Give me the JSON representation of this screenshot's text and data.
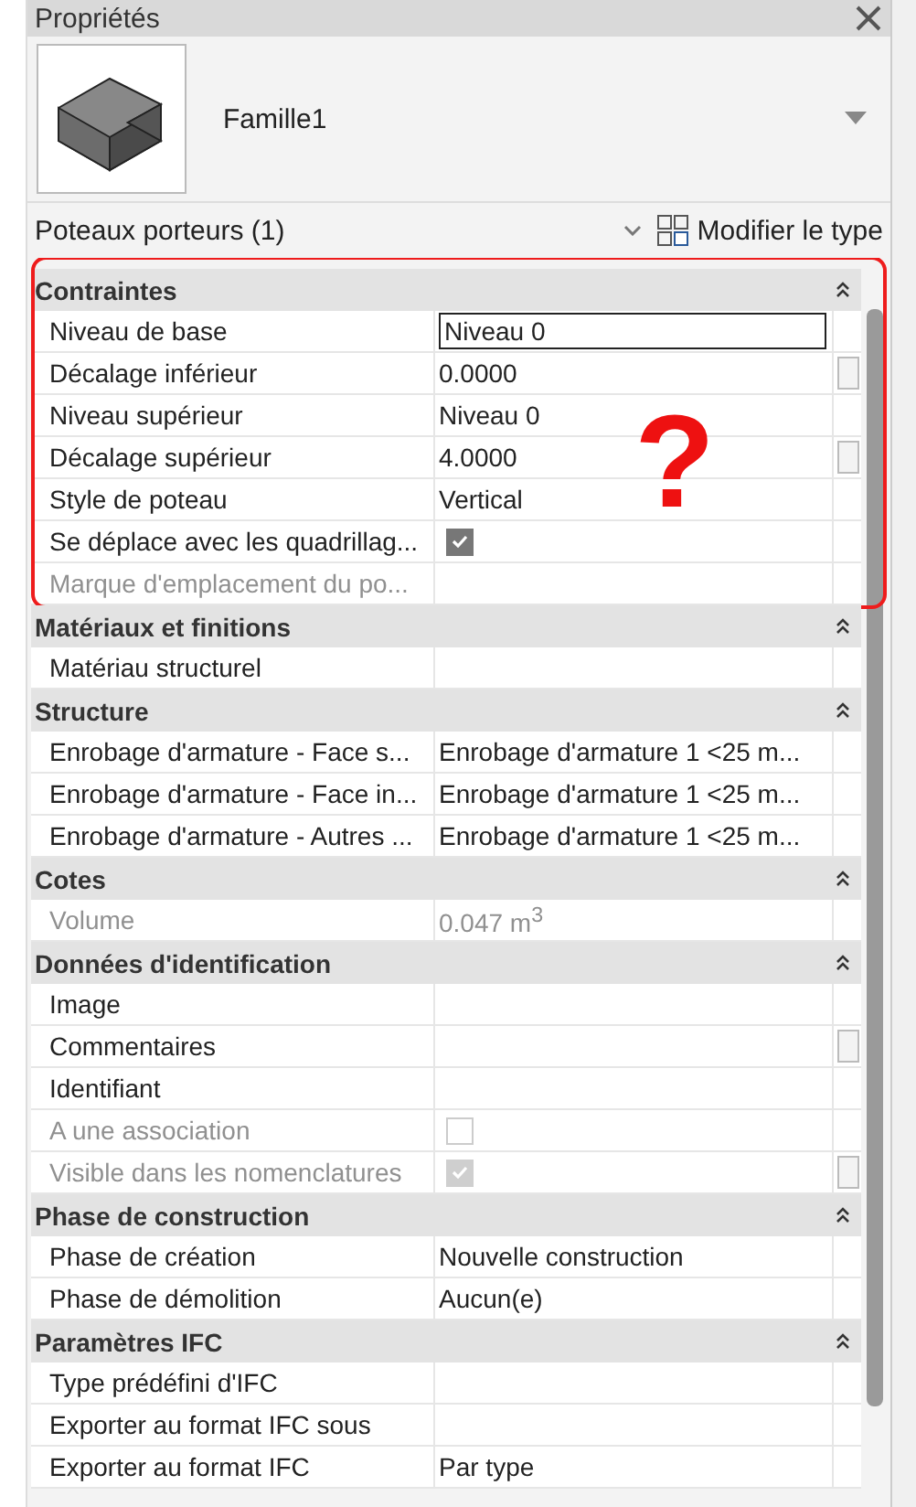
{
  "window": {
    "title": "Propriétés"
  },
  "type_selector": {
    "name": "Famille1"
  },
  "filter": {
    "label": "Poteaux porteurs (1)",
    "edit_type": "Modifier le type"
  },
  "annotation": {
    "mark": "?"
  },
  "sections": [
    {
      "title": "Contraintes",
      "expanded": true,
      "highlighted": true,
      "rows": [
        {
          "kind": "text",
          "label": "Niveau de base",
          "value": "Niveau 0",
          "disabled": false,
          "editing": true,
          "button": false
        },
        {
          "kind": "text",
          "label": "Décalage inférieur",
          "value": "0.0000",
          "disabled": false,
          "editing": false,
          "button": true
        },
        {
          "kind": "text",
          "label": "Niveau supérieur",
          "value": "Niveau 0",
          "disabled": false,
          "editing": false,
          "button": false
        },
        {
          "kind": "text",
          "label": "Décalage supérieur",
          "value": "4.0000",
          "disabled": false,
          "editing": false,
          "button": true
        },
        {
          "kind": "text",
          "label": "Style de poteau",
          "value": "Vertical",
          "disabled": false,
          "editing": false,
          "button": false
        },
        {
          "kind": "checkbox",
          "label": "Se déplace avec les quadrillag...",
          "checked": true,
          "disabled": false,
          "button": false
        },
        {
          "kind": "text",
          "label": "Marque d'emplacement du po...",
          "value": "",
          "disabled": true,
          "editing": false,
          "button": false
        }
      ]
    },
    {
      "title": "Matériaux et finitions",
      "expanded": true,
      "rows": [
        {
          "kind": "text",
          "label": "Matériau structurel",
          "value": "",
          "disabled": false,
          "editing": false,
          "button": false
        }
      ]
    },
    {
      "title": "Structure",
      "expanded": true,
      "rows": [
        {
          "kind": "text",
          "label": "Enrobage d'armature - Face s...",
          "value": "Enrobage d'armature 1 <25 m...",
          "disabled": false,
          "editing": false,
          "button": false
        },
        {
          "kind": "text",
          "label": "Enrobage d'armature - Face in...",
          "value": "Enrobage d'armature 1 <25 m...",
          "disabled": false,
          "editing": false,
          "button": false
        },
        {
          "kind": "text",
          "label": "Enrobage d'armature - Autres ...",
          "value": "Enrobage d'armature 1 <25 m...",
          "disabled": false,
          "editing": false,
          "button": false
        }
      ]
    },
    {
      "title": "Cotes",
      "expanded": true,
      "rows": [
        {
          "kind": "text",
          "label": "Volume",
          "value": "0.047 m$^{3}$",
          "disabled": true,
          "editing": false,
          "button": false
        }
      ]
    },
    {
      "title": "Données d'identification",
      "expanded": true,
      "rows": [
        {
          "kind": "text",
          "label": "Image",
          "value": "",
          "disabled": false,
          "editing": false,
          "button": false
        },
        {
          "kind": "text",
          "label": "Commentaires",
          "value": "",
          "disabled": false,
          "editing": false,
          "button": true
        },
        {
          "kind": "text",
          "label": "Identifiant",
          "value": "",
          "disabled": false,
          "editing": false,
          "button": false
        },
        {
          "kind": "checkbox",
          "label": "A une association",
          "checked": false,
          "disabled": true,
          "button": false
        },
        {
          "kind": "checkbox",
          "label": "Visible dans les nomenclatures",
          "checked": true,
          "disabled": true,
          "button": true
        }
      ]
    },
    {
      "title": "Phase de construction",
      "expanded": true,
      "rows": [
        {
          "kind": "text",
          "label": "Phase de création",
          "value": "Nouvelle construction",
          "disabled": false,
          "editing": false,
          "button": false
        },
        {
          "kind": "text",
          "label": "Phase de démolition",
          "value": "Aucun(e)",
          "disabled": false,
          "editing": false,
          "button": false
        }
      ]
    },
    {
      "title": "Paramètres IFC",
      "expanded": true,
      "rows": [
        {
          "kind": "text",
          "label": "Type prédéfini d'IFC",
          "value": "",
          "disabled": false,
          "editing": false,
          "button": false
        },
        {
          "kind": "text",
          "label": "Exporter au format IFC sous",
          "value": "",
          "disabled": false,
          "editing": false,
          "button": false
        },
        {
          "kind": "text",
          "label": "Exporter au format IFC",
          "value": "Par type",
          "disabled": false,
          "editing": false,
          "button": false
        }
      ]
    }
  ]
}
